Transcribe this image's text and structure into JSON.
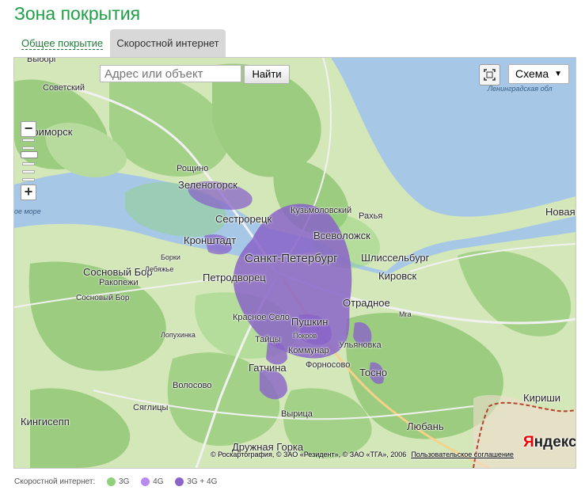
{
  "page": {
    "title": "Зона покрытия"
  },
  "tabs": [
    {
      "label": "Общее покрытие",
      "active": false
    },
    {
      "label": "Скоростной интернет",
      "active": true
    }
  ],
  "map": {
    "search": {
      "placeholder": "Адрес или объект",
      "button_label": "Найти"
    },
    "layer_select": {
      "value": "Схема"
    },
    "zoom": {
      "minus": "−",
      "plus": "+"
    },
    "copyright": "© Роскартография, © ЗАО «Резидент», © ЗАО «ТГА», 2006",
    "agreement_link": "Пользовательское соглашение",
    "logo": {
      "first": "Я",
      "rest": "ндекс"
    },
    "labels": {
      "vyborg": "Выборг",
      "sovetsky": "Советский",
      "primorsk": "Приморск",
      "roshchino": "Рощино",
      "zelenogorsk": "Зеленогорск",
      "sestroretsk": "Сестрорецк",
      "kuzmolovsky": "Кузьмоловский",
      "rakhya": "Рахья",
      "kronshtadt": "Кронштадт",
      "vsevolozhsk": "Всеволожск",
      "spb": "Санкт-Петербург",
      "shlisselburg": "Шлиссельбург",
      "sosnovy_bor": "Сосновый Бор",
      "rakopezhi": "Ракопежи",
      "petrodvorets": "Петродворец",
      "kirovsk": "Кировск",
      "otradnoe": "Отрадное",
      "pushkin": "Пушкин",
      "krasnoe_selo": "Красное Село",
      "taitsy": "Тайцы",
      "kommunar": "Коммунар",
      "gatchina": "Гатчина",
      "fornosovo": "Форносово",
      "tosno": "Тосно",
      "ulyanovka": "Ульяновка",
      "kingisepp": "Кингисепп",
      "syaglitsy": "Сяглицы",
      "volosovo": "Волосово",
      "vyritsa": "Вырица",
      "druzhnaya_gorka": "Дружная Горка",
      "lyuban": "Любань",
      "kirishi": "Кириши",
      "novaya_ladoga": "Новая",
      "leningrad_obl": "Ленинградская обл",
      "gulf": "ое море",
      "mga": "Мга",
      "pokrovka": "Покров",
      "borki": "Борки",
      "lebyazhye": "Лебяжье",
      "sosnovy_bor2": "Сосновый Бор",
      "lopukhinka": "Лопухинка"
    }
  },
  "legend": {
    "label": "Скоростной интернет:",
    "items": [
      {
        "label": "3G",
        "color": "#8fd07a"
      },
      {
        "label": "4G",
        "color": "#b98bf2"
      },
      {
        "label": "3G + 4G",
        "color": "#8a64c8"
      }
    ]
  }
}
